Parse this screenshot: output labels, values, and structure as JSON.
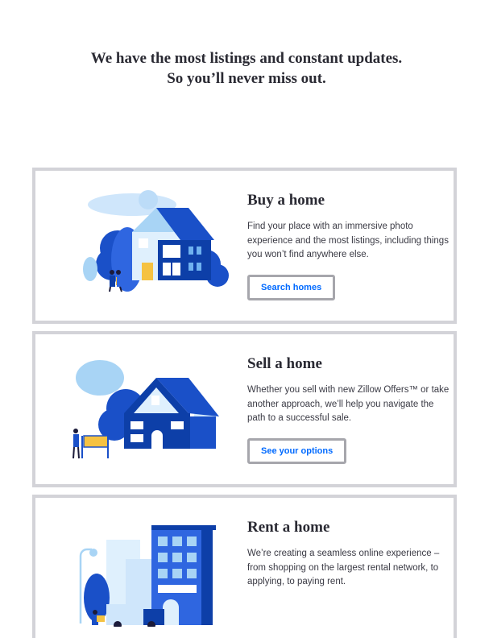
{
  "headline": {
    "line1": "We have the most listings and constant updates.",
    "line2": "So you’ll never miss out."
  },
  "cards": [
    {
      "title": "Buy a home",
      "description": "Find your place with an immersive photo experience and the most listings, including things you won’t find anywhere else.",
      "button": "Search homes",
      "icon": "buy-home-illustration"
    },
    {
      "title": "Sell a home",
      "description": "Whether you sell with new Zillow Offers™ or take another approach, we’ll help you navigate the path to a successful sale.",
      "button": "See your options",
      "icon": "sell-home-illustration"
    },
    {
      "title": "Rent a home",
      "description": "We’re creating a seamless online experience – from shopping on the largest rental network, to applying, to paying rent.",
      "icon": "rent-home-illustration"
    }
  ],
  "colors": {
    "brand_blue": "#006aff",
    "dark_blue": "#0d3fa8",
    "light_blue": "#a8d4f5",
    "card_border": "#d3d3d8",
    "accent_yellow": "#f5c242"
  }
}
